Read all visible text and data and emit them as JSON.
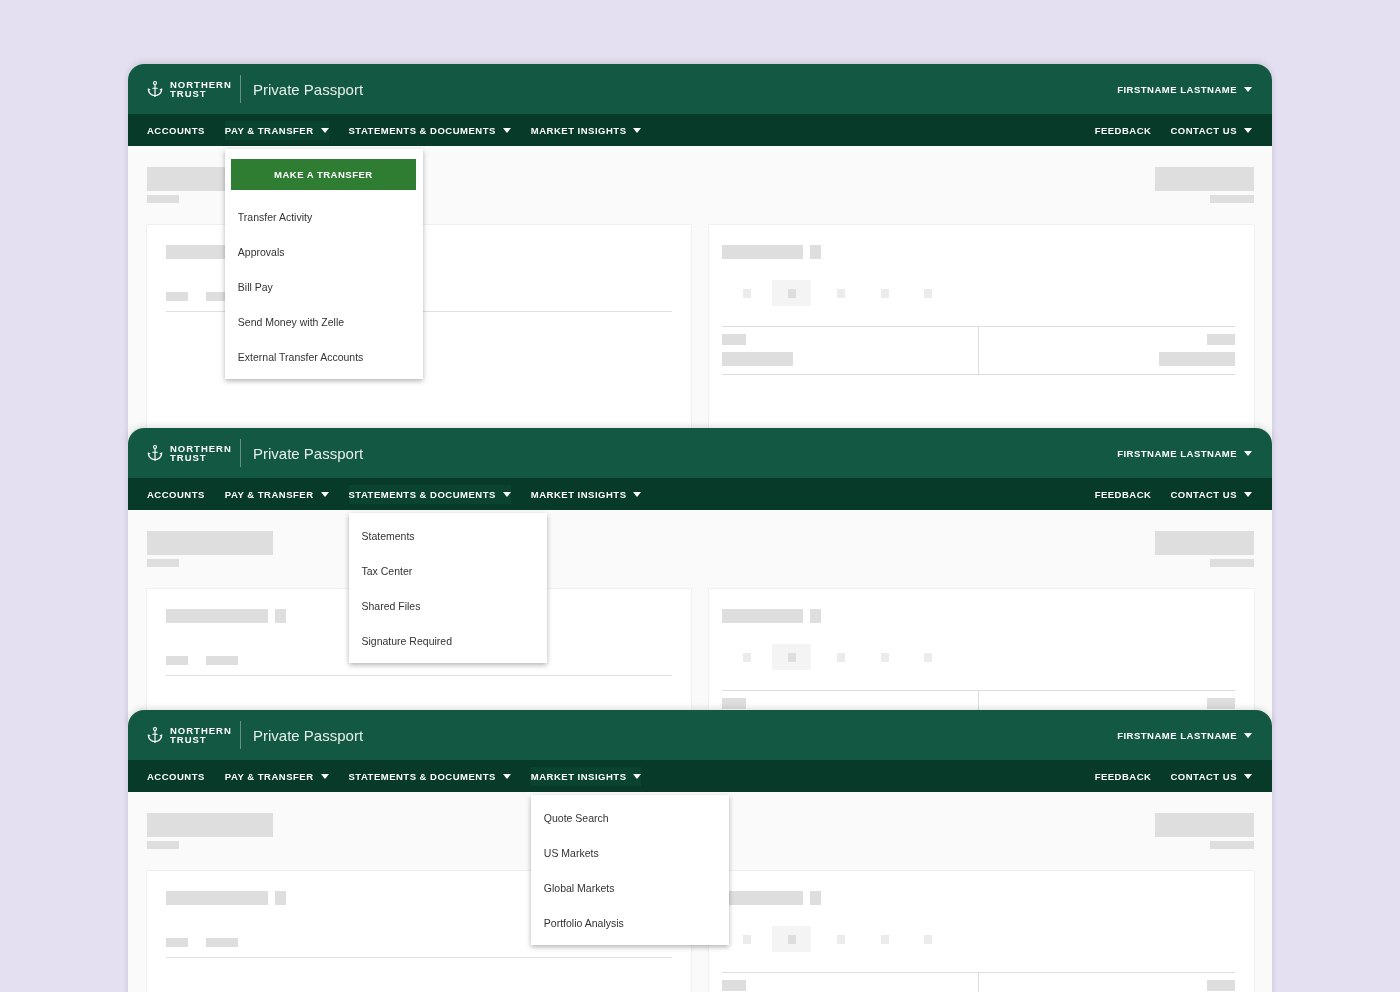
{
  "screens": [
    {
      "brand": "NORTHERN TRUST",
      "app_title": "Private Passport",
      "user_menu": "FIRSTNAME LASTNAME",
      "nav": [
        {
          "label": "ACCOUNTS",
          "has_menu": false,
          "expanded": false
        },
        {
          "label": "PAY & TRANSFER",
          "has_menu": true,
          "expanded": true
        },
        {
          "label": "STATEMENTS & DOCUMENTS",
          "has_menu": true,
          "expanded": false
        },
        {
          "label": "MARKET INSIGHTS",
          "has_menu": true,
          "expanded": false
        }
      ],
      "nav_right": [
        {
          "label": "FEEDBACK",
          "has_menu": false
        },
        {
          "label": "CONTACT US",
          "has_menu": true
        }
      ],
      "dropdown": [
        {
          "label": "MAKE A TRANSFER",
          "kind": "button"
        },
        {
          "label": "Transfer Activity",
          "kind": "link"
        },
        {
          "label": "Approvals",
          "kind": "link"
        },
        {
          "label": "Bill Pay",
          "kind": "link"
        },
        {
          "label": "Send Money with Zelle",
          "kind": "link"
        },
        {
          "label": "External Transfer Accounts",
          "kind": "link"
        }
      ]
    },
    {
      "brand": "NORTHERN TRUST",
      "app_title": "Private Passport",
      "user_menu": "FIRSTNAME LASTNAME",
      "nav": [
        {
          "label": "ACCOUNTS",
          "has_menu": false,
          "expanded": false
        },
        {
          "label": "PAY & TRANSFER",
          "has_menu": true,
          "expanded": false
        },
        {
          "label": "STATEMENTS & DOCUMENTS",
          "has_menu": true,
          "expanded": true
        },
        {
          "label": "MARKET INSIGHTS",
          "has_menu": true,
          "expanded": false
        }
      ],
      "nav_right": [
        {
          "label": "FEEDBACK",
          "has_menu": false
        },
        {
          "label": "CONTACT US",
          "has_menu": true
        }
      ],
      "dropdown": [
        {
          "label": "Statements",
          "kind": "link"
        },
        {
          "label": "Tax Center",
          "kind": "link"
        },
        {
          "label": "Shared Files",
          "kind": "link"
        },
        {
          "label": "Signature Required",
          "kind": "link"
        }
      ]
    },
    {
      "brand": "NORTHERN TRUST",
      "app_title": "Private Passport",
      "user_menu": "FIRSTNAME LASTNAME",
      "nav": [
        {
          "label": "ACCOUNTS",
          "has_menu": false,
          "expanded": false
        },
        {
          "label": "PAY & TRANSFER",
          "has_menu": true,
          "expanded": false
        },
        {
          "label": "STATEMENTS & DOCUMENTS",
          "has_menu": true,
          "expanded": false
        },
        {
          "label": "MARKET INSIGHTS",
          "has_menu": true,
          "expanded": true
        }
      ],
      "nav_right": [
        {
          "label": "FEEDBACK",
          "has_menu": false
        },
        {
          "label": "CONTACT US",
          "has_menu": true
        }
      ],
      "dropdown": [
        {
          "label": "Quote Search",
          "kind": "link"
        },
        {
          "label": "US Markets",
          "kind": "link"
        },
        {
          "label": "Global Markets",
          "kind": "link"
        },
        {
          "label": "Portfolio Analysis",
          "kind": "link"
        }
      ]
    }
  ]
}
